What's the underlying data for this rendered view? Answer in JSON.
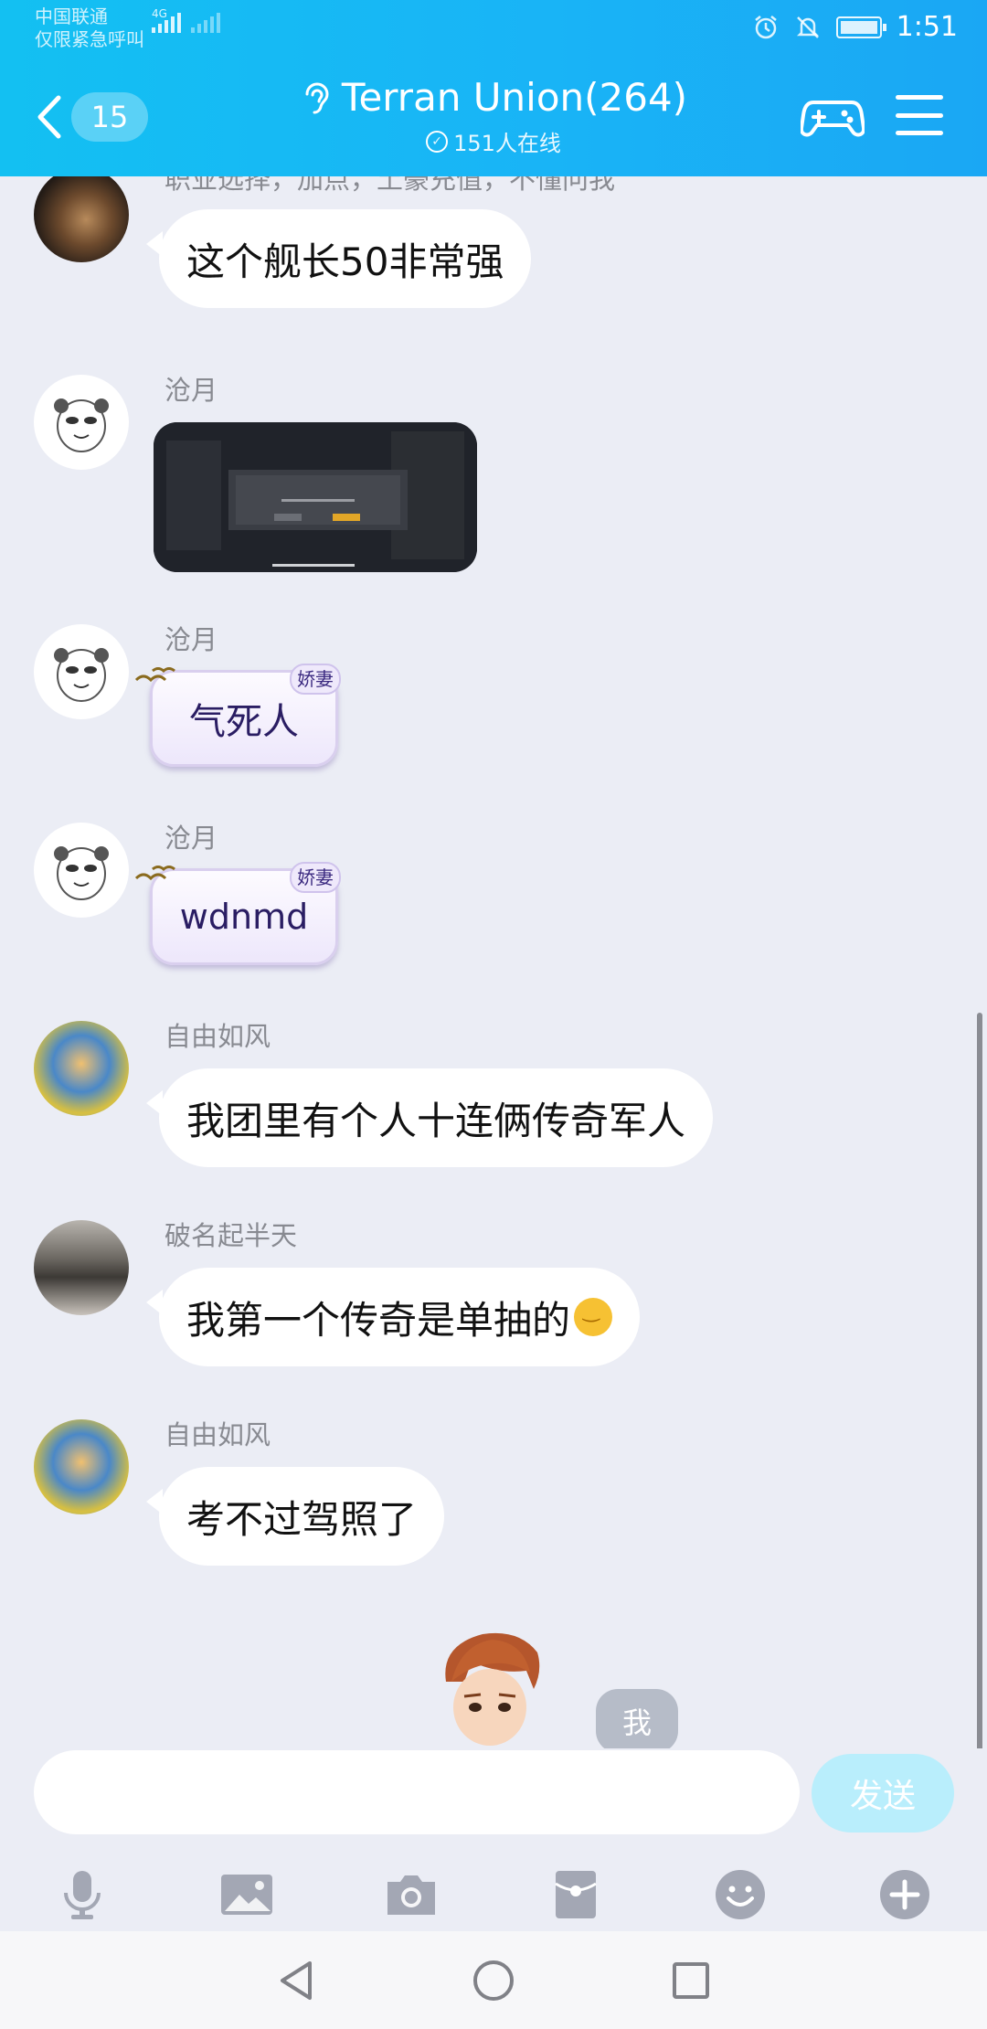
{
  "status_bar": {
    "carrier": "中国联通",
    "carrier_sub": "仅限紧急呼叫",
    "network": "4G",
    "time": "1:51",
    "icons": [
      "alarm-icon",
      "bell-off-icon",
      "battery-icon"
    ]
  },
  "header": {
    "back_count": "15",
    "title": "Terran Union(264)",
    "online": "151人在线",
    "icons": [
      "ear-icon",
      "gamepad-icon",
      "menu-icon"
    ]
  },
  "messages": [
    {
      "sender": "职业选择，加点，土豪充值，不懂问我",
      "type": "text",
      "text": "这个舰长50非常强"
    },
    {
      "sender": "沧月",
      "type": "image",
      "image": "game-screenshot"
    },
    {
      "sender": "沧月",
      "type": "sticker",
      "text": "气死人",
      "tag": "娇妻"
    },
    {
      "sender": "沧月",
      "type": "sticker",
      "text": "wdnmd",
      "tag": "娇妻"
    },
    {
      "sender": "自由如风",
      "type": "text",
      "text": "我团里有个人十连俩传奇军人"
    },
    {
      "sender": "破名起半天",
      "type": "text",
      "text": "我第一个传奇是单抽的",
      "emoji": "shy-emoji"
    },
    {
      "sender": "自由如风",
      "type": "text",
      "text": "考不过驾照了"
    }
  ],
  "me": {
    "label": "我"
  },
  "composer": {
    "placeholder": "",
    "send_label": "发送",
    "tools": [
      "mic-icon",
      "image-icon",
      "camera-icon",
      "red-packet-icon",
      "emoji-icon",
      "plus-icon"
    ]
  },
  "nav": [
    "back-triangle-icon",
    "home-circle-icon",
    "recents-square-icon"
  ],
  "colors": {
    "header": "#19b4f6",
    "background": "#ebedf5",
    "send_disabled": "#b9eefc"
  }
}
